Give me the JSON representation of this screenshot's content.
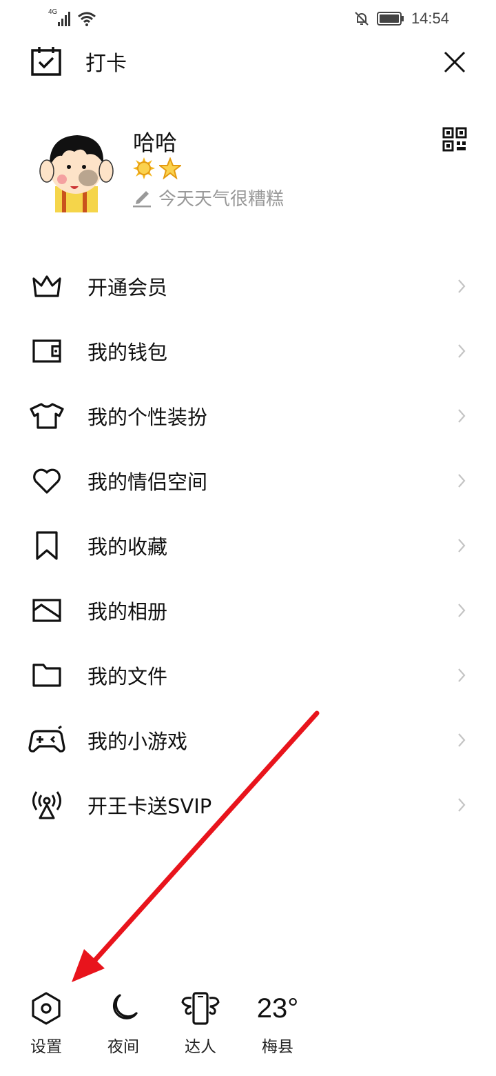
{
  "status_bar": {
    "network": "4G",
    "time": "14:54"
  },
  "header": {
    "checkin_label": "打卡"
  },
  "profile": {
    "username": "哈哈",
    "signature": "今天天气很糟糕"
  },
  "menu": [
    {
      "label": "开通会员",
      "icon": "crown-icon"
    },
    {
      "label": "我的钱包",
      "icon": "wallet-icon"
    },
    {
      "label": "我的个性装扮",
      "icon": "tshirt-icon"
    },
    {
      "label": "我的情侣空间",
      "icon": "heart-icon"
    },
    {
      "label": "我的收藏",
      "icon": "bookmark-icon"
    },
    {
      "label": "我的相册",
      "icon": "photo-icon"
    },
    {
      "label": "我的文件",
      "icon": "folder-icon"
    },
    {
      "label": "我的小游戏",
      "icon": "gamepad-icon"
    },
    {
      "label": "开王卡送SVIP",
      "icon": "antenna-icon"
    }
  ],
  "bottom_bar": {
    "settings_label": "设置",
    "night_label": "夜间",
    "daren_label": "达人",
    "temperature": "23°",
    "city": "梅县"
  },
  "colors": {
    "text": "#111111",
    "muted": "#999999",
    "chevron": "#c4c4c4",
    "arrow": "#e8141c"
  }
}
